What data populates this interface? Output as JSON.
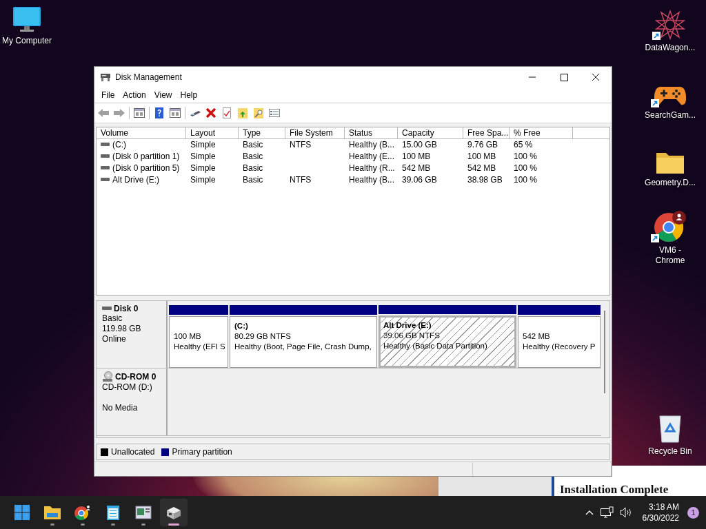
{
  "desktop_icons_left": [
    {
      "label": "My Computer",
      "kind": "monitor",
      "shortcut": false
    }
  ],
  "desktop_icons_right": [
    {
      "label": "DataWagon...",
      "kind": "star",
      "shortcut": true
    },
    {
      "label": "SearchGam...",
      "kind": "gamepad",
      "shortcut": true
    },
    {
      "label": "Geometry.D...",
      "kind": "folder",
      "shortcut": false
    },
    {
      "label": "VM6 - Chrome",
      "kind": "browser",
      "shortcut": true
    },
    {
      "label": "Recycle Bin",
      "kind": "bin",
      "shortcut": false
    }
  ],
  "background_window": {
    "title": "Installation Complete"
  },
  "window": {
    "title": "Disk Management"
  },
  "menu": [
    "File",
    "Action",
    "View",
    "Help"
  ],
  "volumes": {
    "columns": [
      "Volume",
      "Layout",
      "Type",
      "File System",
      "Status",
      "Capacity",
      "Free Spa...",
      "% Free"
    ],
    "rows": [
      [
        "(C:)",
        "Simple",
        "Basic",
        "NTFS",
        "Healthy (B...",
        "15.00 GB",
        "9.76 GB",
        "65 %"
      ],
      [
        "(Disk 0 partition 1)",
        "Simple",
        "Basic",
        "",
        "Healthy (E...",
        "100 MB",
        "100 MB",
        "100 %"
      ],
      [
        "(Disk 0 partition 5)",
        "Simple",
        "Basic",
        "",
        "Healthy (R...",
        "542 MB",
        "542 MB",
        "100 %"
      ],
      [
        "Alt Drive (E:)",
        "Simple",
        "Basic",
        "NTFS",
        "Healthy (B...",
        "39.06 GB",
        "38.98 GB",
        "100 %"
      ]
    ]
  },
  "disks": [
    {
      "name": "Disk 0",
      "kind": "disk",
      "lines": [
        "Basic",
        "119.98 GB",
        "Online"
      ],
      "partitions": [
        {
          "lines": [
            "100 MB",
            "Healthy (EFI S"
          ],
          "selected": false
        },
        {
          "title": "(C:)",
          "lines": [
            "80.29 GB NTFS",
            "Healthy (Boot, Page File, Crash Dump,"
          ],
          "selected": false
        },
        {
          "title": "Alt Drive  (E:)",
          "lines": [
            "39.06 GB NTFS",
            "Healthy (Basic Data Partition)"
          ],
          "selected": true
        },
        {
          "lines": [
            "542 MB",
            "Healthy (Recovery P"
          ],
          "selected": false
        }
      ]
    },
    {
      "name": "CD-ROM 0",
      "kind": "cdrom",
      "lines": [
        "CD-ROM (D:)",
        "No Media"
      ]
    }
  ],
  "legend": [
    {
      "label": "Unallocated",
      "color": "#000000"
    },
    {
      "label": "Primary partition",
      "color": "#000080"
    }
  ],
  "taskbar": {
    "apps": [
      {
        "kind": "start",
        "selected": false
      },
      {
        "kind": "explorer",
        "selected": false
      },
      {
        "kind": "browser",
        "selected": false
      },
      {
        "kind": "notepad",
        "selected": false
      },
      {
        "kind": "viewer",
        "selected": false
      },
      {
        "kind": "disk",
        "selected": true
      }
    ],
    "time": "3:18 AM",
    "date": "6/30/2022",
    "notifications": "1"
  }
}
